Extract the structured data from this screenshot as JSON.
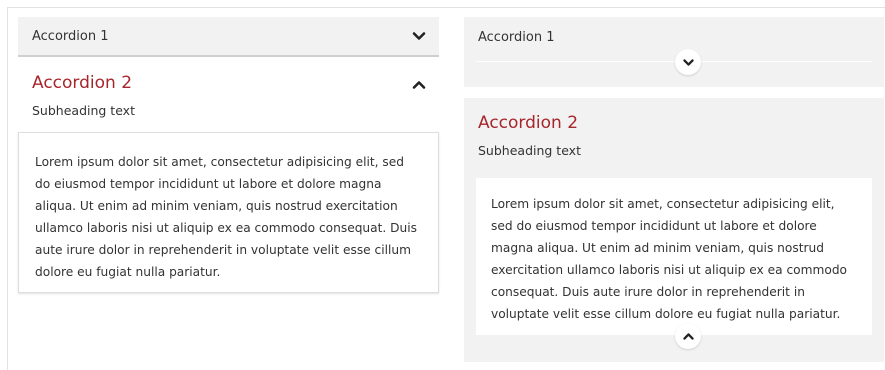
{
  "left_panel": {
    "accordion_1": {
      "label": "Accordion 1",
      "icon": "chevron-down-icon",
      "expanded": false
    },
    "accordion_2": {
      "label": "Accordion 2",
      "subheading": "Subheading text",
      "icon": "chevron-up-icon",
      "expanded": true,
      "body": "Lorem ipsum dolor sit amet, consectetur adipisicing elit, sed do eiusmod tempor incididunt ut labore et dolore magna aliqua. Ut enim ad minim veniam, quis nostrud exercitation ullamco laboris nisi ut aliquip ex ea commodo consequat. Duis aute irure dolor in reprehenderit in voluptate velit esse cillum dolore eu fugiat nulla pariatur."
    }
  },
  "right_panel": {
    "accordion_1": {
      "label": "Accordion 1",
      "icon": "chevron-down-icon",
      "expanded": false
    },
    "accordion_2": {
      "label": "Accordion 2",
      "subheading": "Subheading text",
      "icon": "chevron-up-icon",
      "expanded": true,
      "body": "Lorem ipsum dolor sit amet, consectetur adipisicing elit, sed do eiusmod tempor incididunt ut labore et dolore magna aliqua. Ut enim ad minim veniam, quis nostrud exercitation ullamco laboris nisi ut aliquip ex ea commodo consequat. Duis aute irure dolor in reprehenderit in voluptate velit esse cillum dolore eu fugiat nulla pariatur."
    }
  },
  "colors": {
    "heading_accent": "#a6262c",
    "panel_background": "#f2f2f2",
    "text": "#333333"
  }
}
